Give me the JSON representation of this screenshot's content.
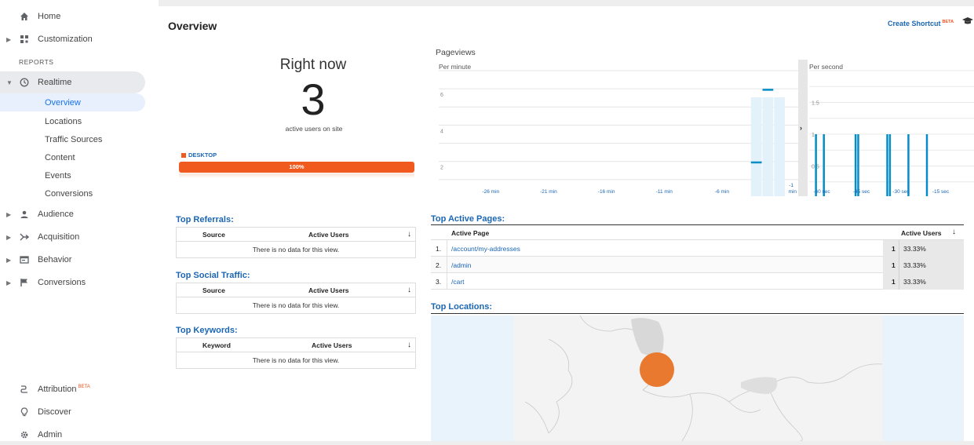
{
  "sidebar": {
    "home": "Home",
    "customization": "Customization",
    "reports_header": "REPORTS",
    "realtime": "Realtime",
    "realtime_items": [
      "Overview",
      "Locations",
      "Traffic Sources",
      "Content",
      "Events",
      "Conversions"
    ],
    "audience": "Audience",
    "acquisition": "Acquisition",
    "behavior": "Behavior",
    "conversions": "Conversions",
    "attribution": "Attribution",
    "attribution_badge": "BETA",
    "discover": "Discover",
    "admin": "Admin"
  },
  "header": {
    "title": "Overview",
    "create_shortcut": "Create Shortcut",
    "shortcut_badge": "BETA"
  },
  "right_now": {
    "title": "Right now",
    "count": "3",
    "subtitle": "active users on site",
    "device_label": "DESKTOP",
    "device_percent": "100%",
    "device_fraction": 1.0
  },
  "pageviews": {
    "title": "Pageviews",
    "per_minute_label": "Per minute",
    "per_second_label": "Per second",
    "minute_y_ticks": [
      "6",
      "4",
      "2"
    ],
    "second_y_ticks": [
      "1.5",
      "1",
      "0.5"
    ],
    "minute_x_ticks": [
      "-26 min",
      "-21 min",
      "-16 min",
      "-11 min",
      "-6 min",
      "-1 min"
    ],
    "second_x_ticks": [
      "-60 sec",
      "-45 sec",
      "-30 sec",
      "-15 sec"
    ]
  },
  "chart_data": [
    {
      "type": "bar",
      "title": "Per minute",
      "x": [
        -30,
        -29,
        -28,
        -27,
        -26,
        -25,
        -24,
        -23,
        -22,
        -21,
        -20,
        -19,
        -18,
        -17,
        -16,
        -15,
        -14,
        -13,
        -12,
        -11,
        -10,
        -9,
        -8,
        -7,
        -6,
        -5,
        -4,
        -3,
        -2,
        -1
      ],
      "values": [
        0,
        0,
        0,
        0,
        0,
        0,
        0,
        0,
        0,
        0,
        0,
        0,
        0,
        0,
        0,
        0,
        0,
        0,
        0,
        0,
        0,
        0,
        0,
        0,
        0,
        0,
        0,
        2,
        6,
        0
      ],
      "ylim": [
        0,
        7
      ],
      "color": "#058dc7"
    },
    {
      "type": "bar",
      "title": "Per second",
      "x": [
        -59,
        -56,
        -44,
        -43,
        -32,
        -31,
        -24,
        -17
      ],
      "values": [
        1,
        1,
        1,
        1,
        1,
        1,
        1,
        1
      ],
      "ylim": [
        0,
        2
      ],
      "color": "#058dc7"
    }
  ],
  "top_referrals": {
    "title": "Top Referrals:",
    "col_source": "Source",
    "col_users": "Active Users",
    "sort_icon": "↓",
    "empty": "There is no data for this view."
  },
  "top_social": {
    "title": "Top Social Traffic:",
    "col_source": "Source",
    "col_users": "Active Users",
    "sort_icon": "↓",
    "empty": "There is no data for this view."
  },
  "top_keywords": {
    "title": "Top Keywords:",
    "col_keyword": "Keyword",
    "col_users": "Active Users",
    "sort_icon": "↓",
    "empty": "There is no data for this view."
  },
  "top_pages": {
    "title": "Top Active Pages:",
    "col_page": "Active Page",
    "col_users": "Active Users",
    "sort_icon": "↓",
    "rows": [
      {
        "idx": "1.",
        "page": "/account/my-addresses",
        "count": "1",
        "pct": "33.33%"
      },
      {
        "idx": "2.",
        "page": "/admin",
        "count": "1",
        "pct": "33.33%"
      },
      {
        "idx": "3.",
        "page": "/cart",
        "count": "1",
        "pct": "33.33%"
      }
    ]
  },
  "top_locations": {
    "title": "Top Locations:"
  },
  "colors": {
    "accent": "#1b66b4",
    "device_bar": "#f05a1f",
    "chart_bar": "#058dc7",
    "map_marker": "#e8792f"
  }
}
